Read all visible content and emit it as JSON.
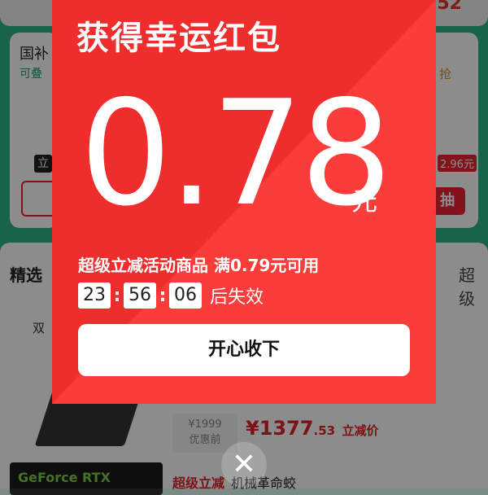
{
  "background": {
    "top_number_fragment": "52",
    "promo_card_title": "国补",
    "promo_card_subtitle": "可叠",
    "li_badge": "立",
    "grab_text": "抢",
    "right_price": "2.96元",
    "draw_button": "抽",
    "tab_selected": "精选",
    "tab_right": "超级",
    "product_title_fragment": "双",
    "old_price": "¥1999",
    "old_price_label": "优惠前",
    "current_price_int": "¥1377",
    "current_price_dec": ".53",
    "current_price_tag": "立减价",
    "gpu_banner": "GeForce RTX",
    "super_title": "超级立减",
    "super_title_product": "机械革命蛟"
  },
  "red_packet": {
    "title": "获得幸运红包",
    "amount": "0.78",
    "unit": "元",
    "description": "超级立减活动商品 满0.79元可用",
    "timer": {
      "hours": "23",
      "minutes": "56",
      "seconds": "06"
    },
    "expire_text": "后失效",
    "accept_button": "开心收下",
    "close_icon": "close-icon"
  },
  "colors": {
    "packet_red": "#ef2d2d",
    "packet_red_light": "#fa3c3a",
    "app_green": "#2bb58a",
    "price_red": "#e2222a"
  }
}
